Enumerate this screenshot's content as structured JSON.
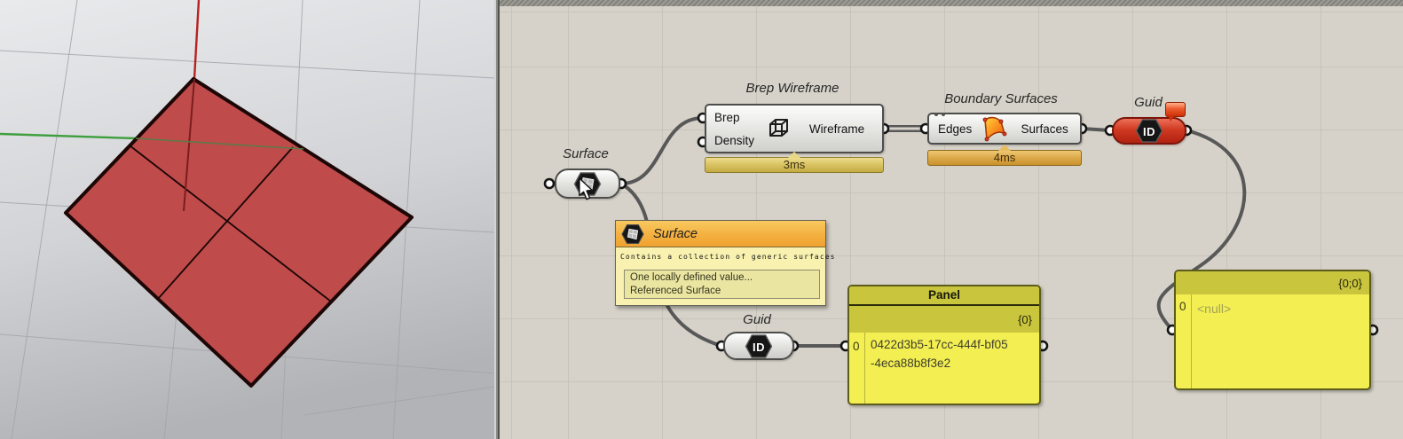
{
  "colors": {
    "canvas_bg": "#d6d2c9",
    "viewport_bg": "#dfe0e2",
    "surface_fill": "#bf4b4b",
    "axis_red": "#b92222",
    "axis_green": "#3f9f3f",
    "wire": "#585858",
    "panel_yellow": "#f3ee52",
    "panel_olive": "#c9c53d",
    "param_red": "#c22f1c",
    "profiler_3ms": "#d8c261",
    "profiler_4ms": "#dca94a",
    "tooltip_header": "#f3ae3e"
  },
  "canvas": {
    "surface_param": {
      "label": "Surface"
    },
    "brep_wireframe": {
      "label": "Brep Wireframe",
      "inputs": [
        "Brep",
        "Density"
      ],
      "output": "Wireframe",
      "time": "3ms"
    },
    "boundary_surfaces": {
      "label": "Boundary Surfaces",
      "input": "Edges",
      "output": "Surfaces",
      "time": "4ms"
    },
    "guid_top": {
      "label": "Guid",
      "icon_text": "ID"
    },
    "guid_bottom": {
      "label": "Guid",
      "icon_text": "ID"
    },
    "tooltip": {
      "title": "Surface",
      "description": "Contains a collection of generic surfaces",
      "line1": "One locally defined value...",
      "line2": "Referenced Surface"
    },
    "panel1": {
      "title": "Panel",
      "path": "{0}",
      "index": "0",
      "value": "0422d3b5-17cc-444f-bf05-4eca88b8f3e2"
    },
    "panel2": {
      "path": "{0;0}",
      "index": "0",
      "value": "<null>"
    }
  }
}
